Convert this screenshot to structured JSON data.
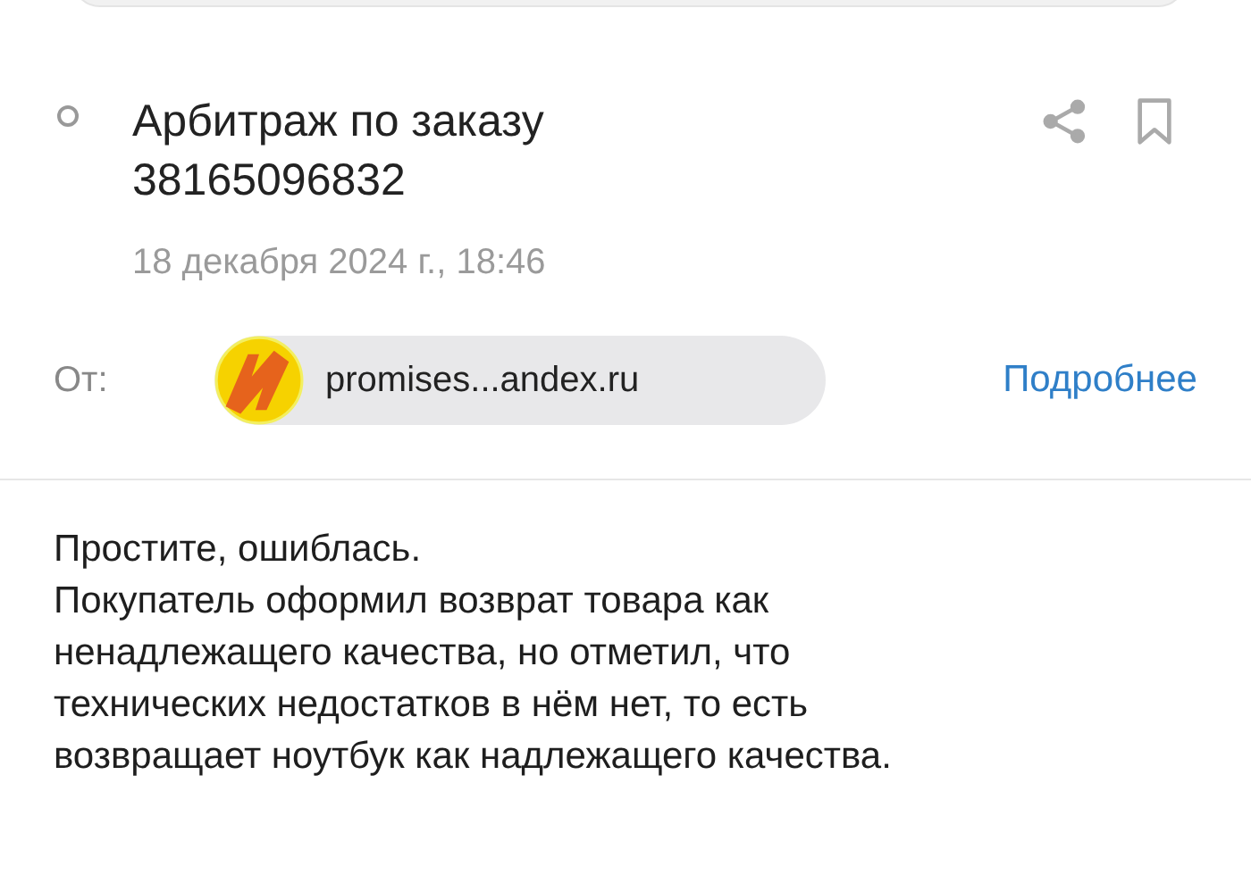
{
  "message": {
    "unread": false,
    "subject_lines": [
      "Арбитраж по заказу",
      "38165096832"
    ],
    "date": "18 декабря 2024 г., 18:46"
  },
  "sender": {
    "label": "От:",
    "address": "promises...andex.ru",
    "details_link": "Подробнее"
  },
  "body": [
    [
      "Простите, ошиблась."
    ],
    [
      "Покупатель оформил возврат товара как",
      "ненадлежащего качества, но отметил, что",
      "технических недостатков в нём нет, то есть",
      "возвращает ноутбук как надлежащего качества."
    ]
  ]
}
